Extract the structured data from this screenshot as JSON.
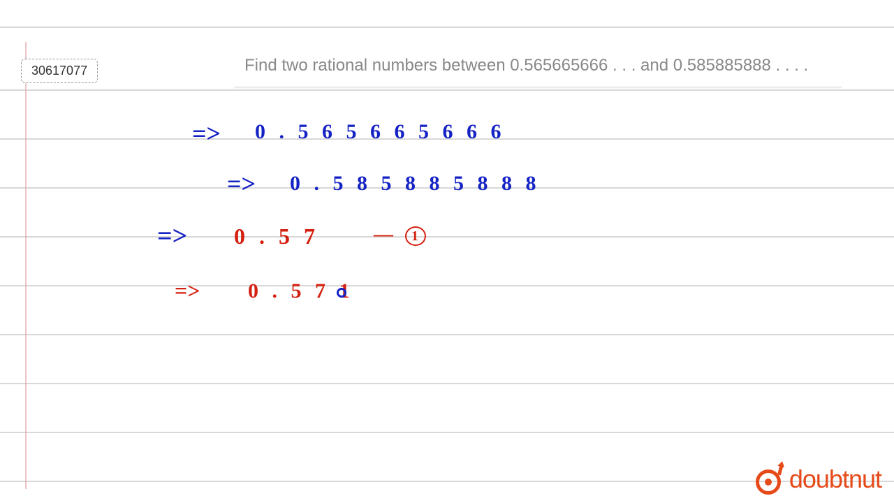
{
  "question": {
    "id": "30617077",
    "text": "Find two rational numbers between 0.565665666 . . . and 0.585885888 . . . ."
  },
  "handwriting": {
    "line1": {
      "arrow": "=>",
      "value": "0 . 5 6 5 6 6 5 6 6 6"
    },
    "line2": {
      "arrow": "=>",
      "value": "0 . 5 8 5 8 8 5 8 8 8"
    },
    "line3": {
      "arrow": "=>",
      "value": "0 . 5 7",
      "marker_dash": "—",
      "marker_num": "1"
    },
    "line4": {
      "arrow": "=>",
      "value": "0 . 5 7 1"
    }
  },
  "brand": {
    "name": "doubtnut"
  },
  "colors": {
    "blue_ink": "#1522c4",
    "red_ink": "#d42010",
    "brand": "#e64a19",
    "rule_line": "#d8d8d8",
    "margin_line": "#e0a0a0"
  }
}
